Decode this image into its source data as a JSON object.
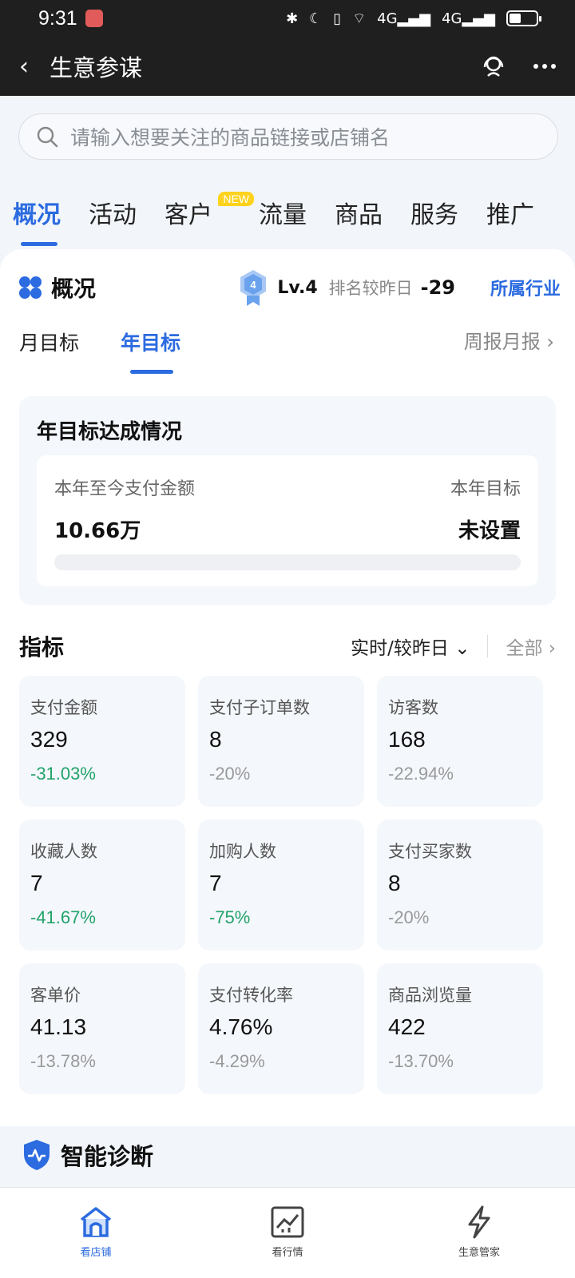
{
  "status_bar": {
    "time": "9:31",
    "network_a": "4G",
    "network_b": "4G",
    "battery_level": 0.45
  },
  "header": {
    "title": "生意参谋"
  },
  "search": {
    "placeholder": "请输入想要关注的商品链接或店铺名"
  },
  "tabs": [
    {
      "label": "概况",
      "active": true
    },
    {
      "label": "活动"
    },
    {
      "label": "客户",
      "badge": "NEW"
    },
    {
      "label": "流量"
    },
    {
      "label": "商品"
    },
    {
      "label": "服务"
    },
    {
      "label": "推广"
    }
  ],
  "overview": {
    "title": "概况",
    "level_number": "4",
    "level_text": "Lv.4",
    "rank_label": "排名较昨日",
    "rank_change": "-29",
    "industry_link": "所属行业"
  },
  "sub_tabs": {
    "month": "月目标",
    "year": "年目标",
    "report": "周报月报"
  },
  "goal": {
    "title": "年目标达成情况",
    "paid_label": "本年至今支付金额",
    "paid_value": "10.66万",
    "target_label": "本年目标",
    "target_value": "未设置",
    "progress": 0
  },
  "metrics": {
    "title": "指标",
    "time_select": "实时/较昨日",
    "all_link": "全部",
    "items": [
      {
        "label": "支付金额",
        "value": "329",
        "change": "-31.03%",
        "highlight": true
      },
      {
        "label": "支付子订单数",
        "value": "8",
        "change": "-20%",
        "highlight": false
      },
      {
        "label": "访客数",
        "value": "168",
        "change": "-22.94%",
        "highlight": false
      },
      {
        "label": "收藏人数",
        "value": "7",
        "change": "-41.67%",
        "highlight": true
      },
      {
        "label": "加购人数",
        "value": "7",
        "change": "-75%",
        "highlight": true
      },
      {
        "label": "支付买家数",
        "value": "8",
        "change": "-20%",
        "highlight": false
      },
      {
        "label": "客单价",
        "value": "41.13",
        "change": "-13.78%",
        "highlight": false
      },
      {
        "label": "支付转化率",
        "value": "4.76%",
        "change": "-4.29%",
        "highlight": false
      },
      {
        "label": "商品浏览量",
        "value": "422",
        "change": "-13.70%",
        "highlight": false
      }
    ]
  },
  "diagnosis": {
    "title": "智能诊断"
  },
  "bottom_nav": [
    {
      "label": "看店铺",
      "active": true
    },
    {
      "label": "看行情"
    },
    {
      "label": "生意管家"
    }
  ],
  "colors": {
    "accent": "#2c6be0",
    "positive_drop": "#22a36a",
    "badge": "#ffd21e"
  }
}
